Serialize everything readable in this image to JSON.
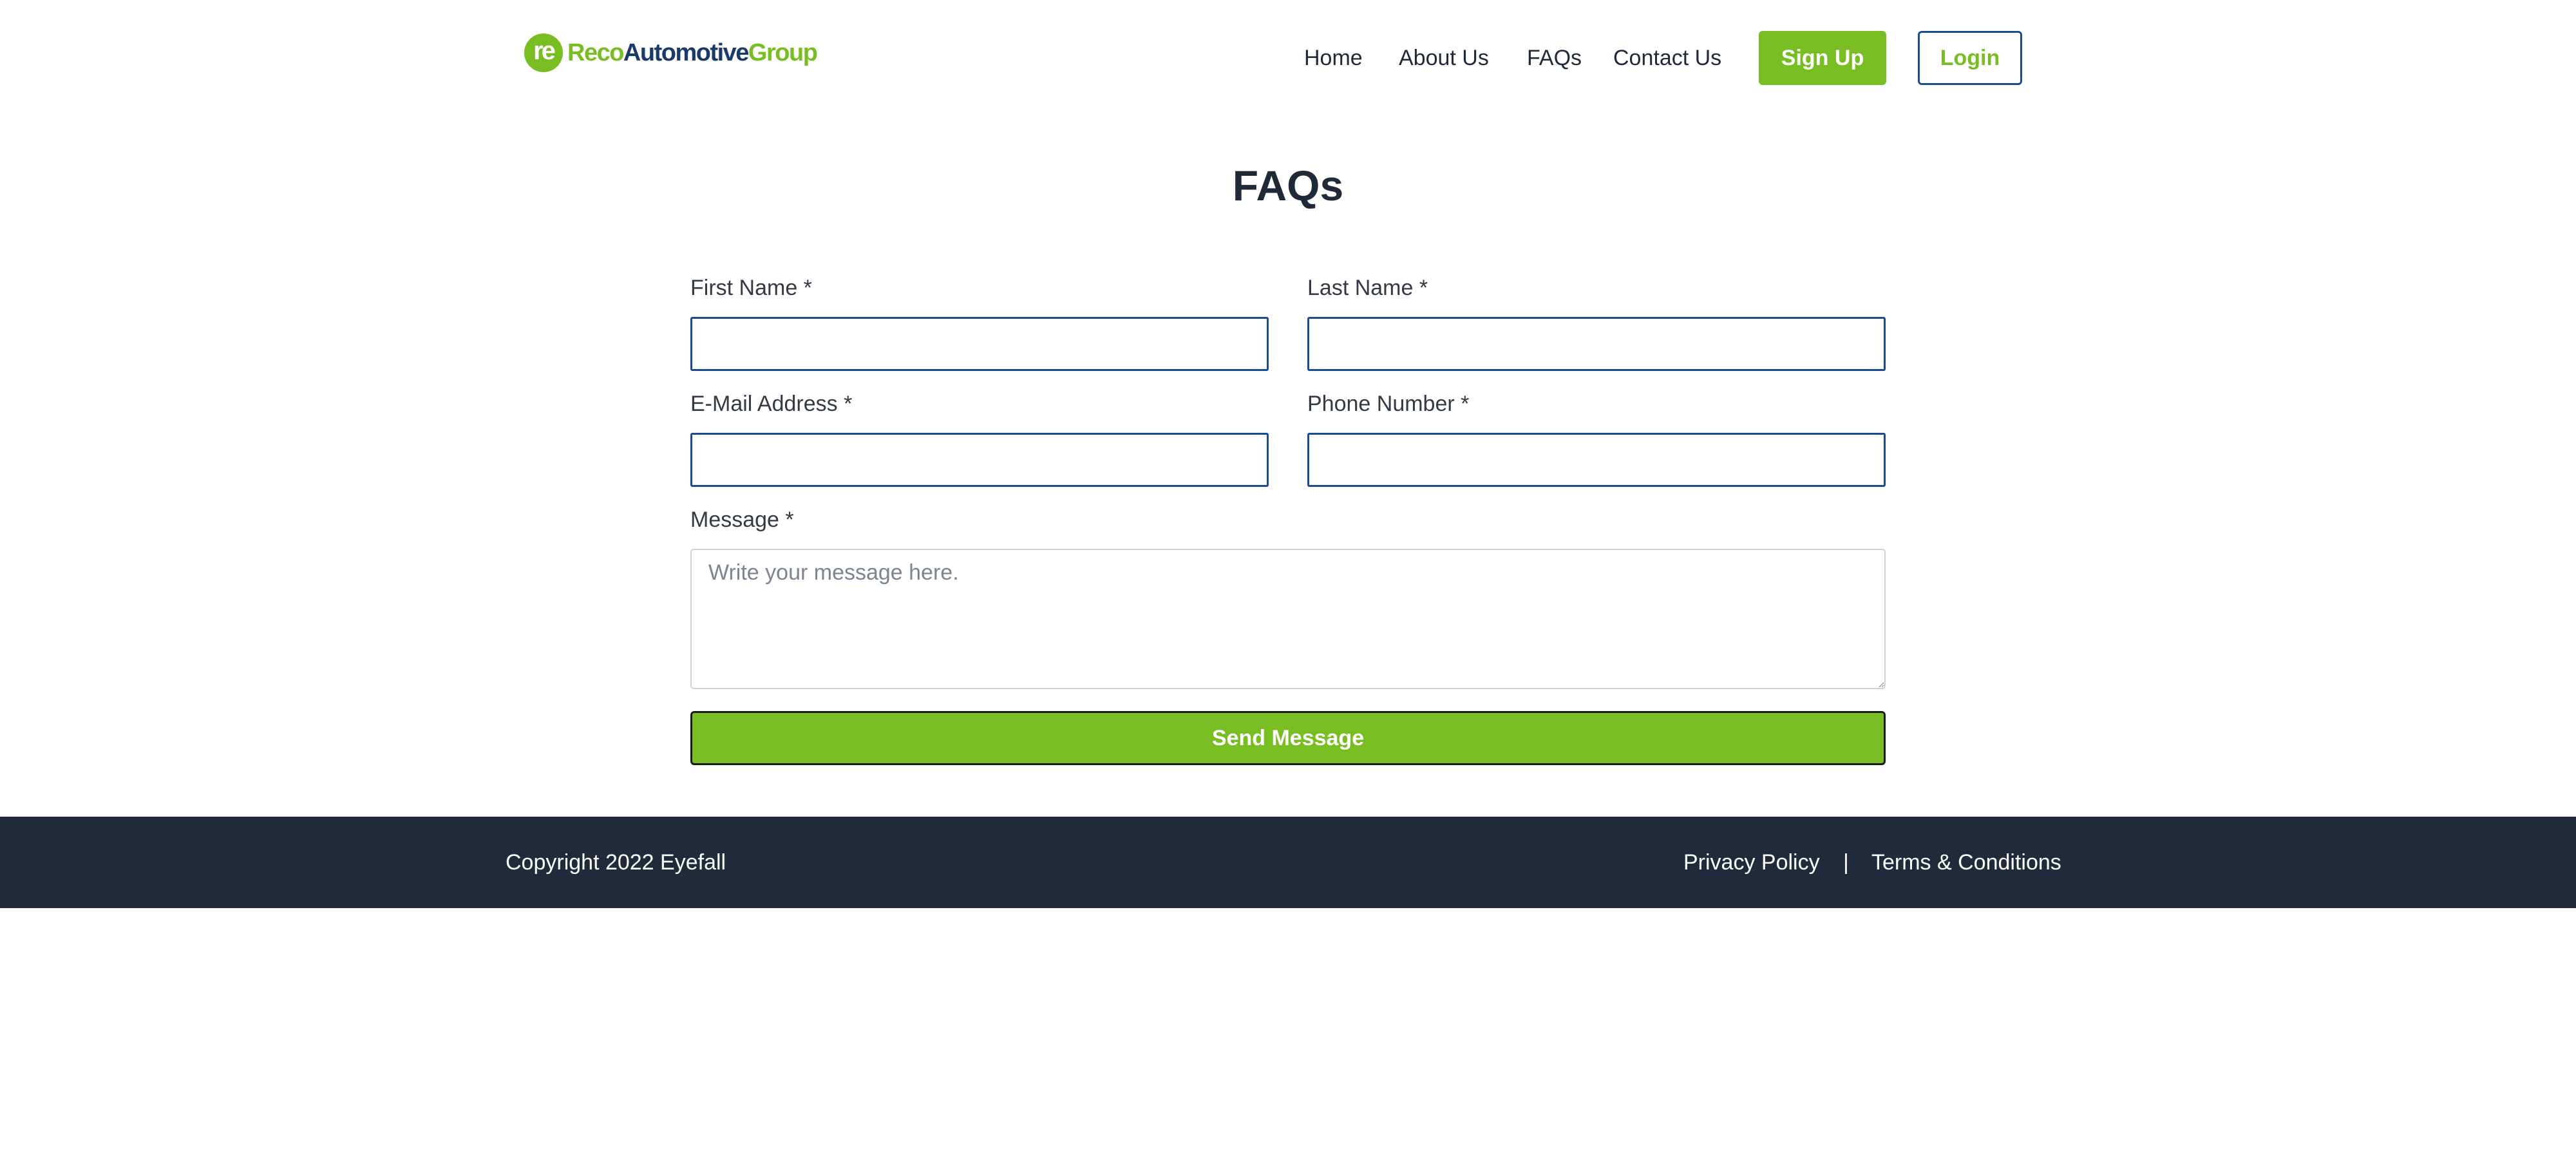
{
  "brand": {
    "logo_mark": "re",
    "name_part1": "Reco",
    "name_part2": "Automotive",
    "name_part3": "Group",
    "accent_color": "#78bd22",
    "navy_color": "#1a3a6b"
  },
  "nav": {
    "items": [
      {
        "label": "Home"
      },
      {
        "label": "About Us"
      },
      {
        "label": "FAQs"
      },
      {
        "label": "Contact Us"
      }
    ],
    "signup_label": "Sign Up",
    "login_label": "Login"
  },
  "page": {
    "title": "FAQs"
  },
  "form": {
    "first_name": {
      "label": "First Name *",
      "value": "",
      "placeholder": ""
    },
    "last_name": {
      "label": "Last Name *",
      "value": "",
      "placeholder": ""
    },
    "email": {
      "label": "E-Mail Address *",
      "value": "",
      "placeholder": ""
    },
    "phone": {
      "label": "Phone Number *",
      "value": "",
      "placeholder": ""
    },
    "message": {
      "label": "Message *",
      "value": "",
      "placeholder": "Write your message here."
    },
    "submit_label": "Send Message"
  },
  "footer": {
    "copyright": "Copyright 2022 Eyefall",
    "privacy_label": "Privacy Policy",
    "separator": "|",
    "terms_label": "Terms & Conditions",
    "background_color": "#202a3a"
  }
}
